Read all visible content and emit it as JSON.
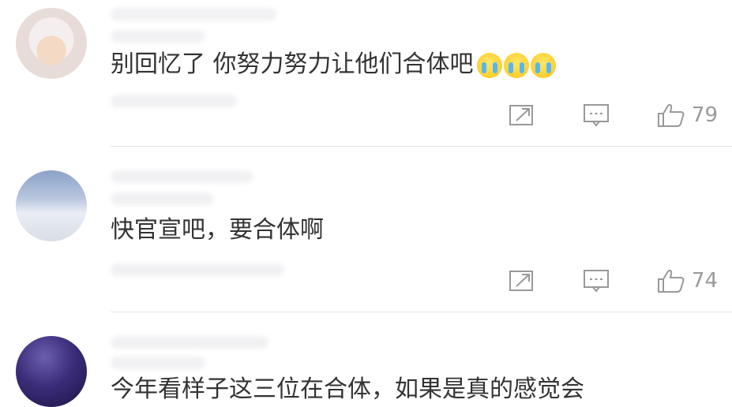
{
  "comments": [
    {
      "text": "别回忆了 你努力努力让他们合体吧",
      "emojis": [
        "crying-face-icon",
        "crying-face-icon",
        "crying-face-icon"
      ],
      "likes": "79"
    },
    {
      "text": "快官宣吧，要合体啊",
      "emojis": [],
      "likes": "74"
    },
    {
      "text": "今年看样子这三位在合体，如果是真的感觉会",
      "emojis": [],
      "likes": ""
    }
  ],
  "colors": {
    "text": "#333333",
    "icon": "#999999",
    "divider": "#e6e6e6"
  }
}
